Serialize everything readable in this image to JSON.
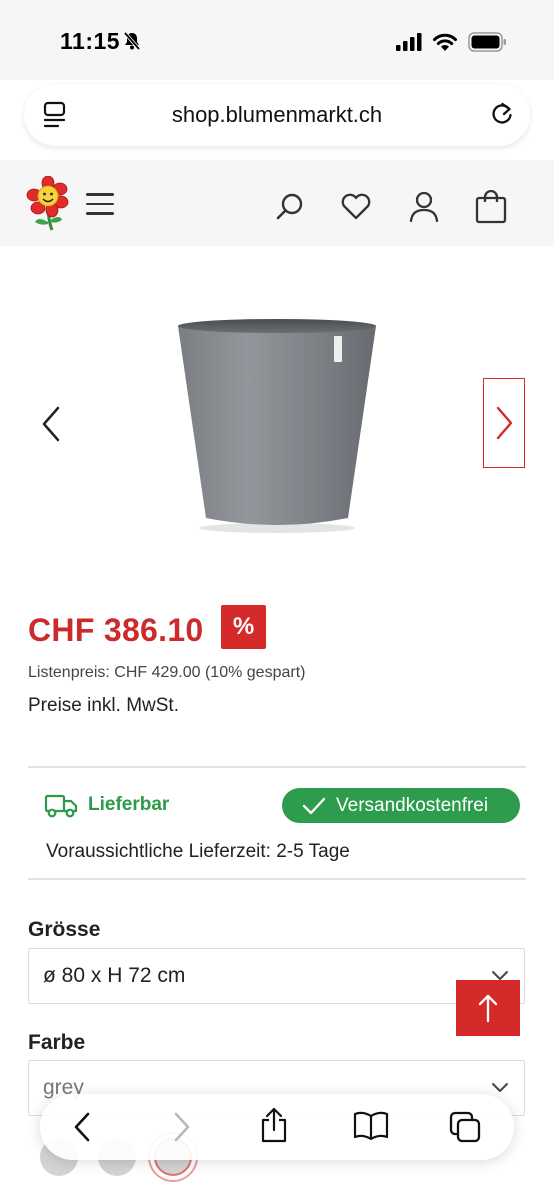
{
  "status_bar": {
    "time": "11:15"
  },
  "browser": {
    "url": "shop.blumenmarkt.ch"
  },
  "header": {
    "logo_icon": "flower-logo-icon",
    "icons": [
      "menu-icon",
      "search-icon",
      "heart-icon",
      "user-icon",
      "bag-icon"
    ]
  },
  "product": {
    "price": "CHF 386.10",
    "discount_badge": "%",
    "list_price": "Listenpreis: CHF 429.00 (10% gespart)",
    "vat_note": "Preise inkl. MwSt."
  },
  "delivery": {
    "availability": "Lieferbar",
    "shipping_badge": "Versandkostenfrei",
    "delivery_time": "Voraussichtliche Lieferzeit: 2-5 Tage"
  },
  "options": {
    "size_label": "Grösse",
    "size_value": "ø 80 x H 72 cm",
    "color_label": "Farbe",
    "color_value": "grey"
  },
  "colors": {
    "accent_red": "#d42a2a",
    "price_red": "#cc2b2b",
    "success_green": "#2e9c4d"
  }
}
